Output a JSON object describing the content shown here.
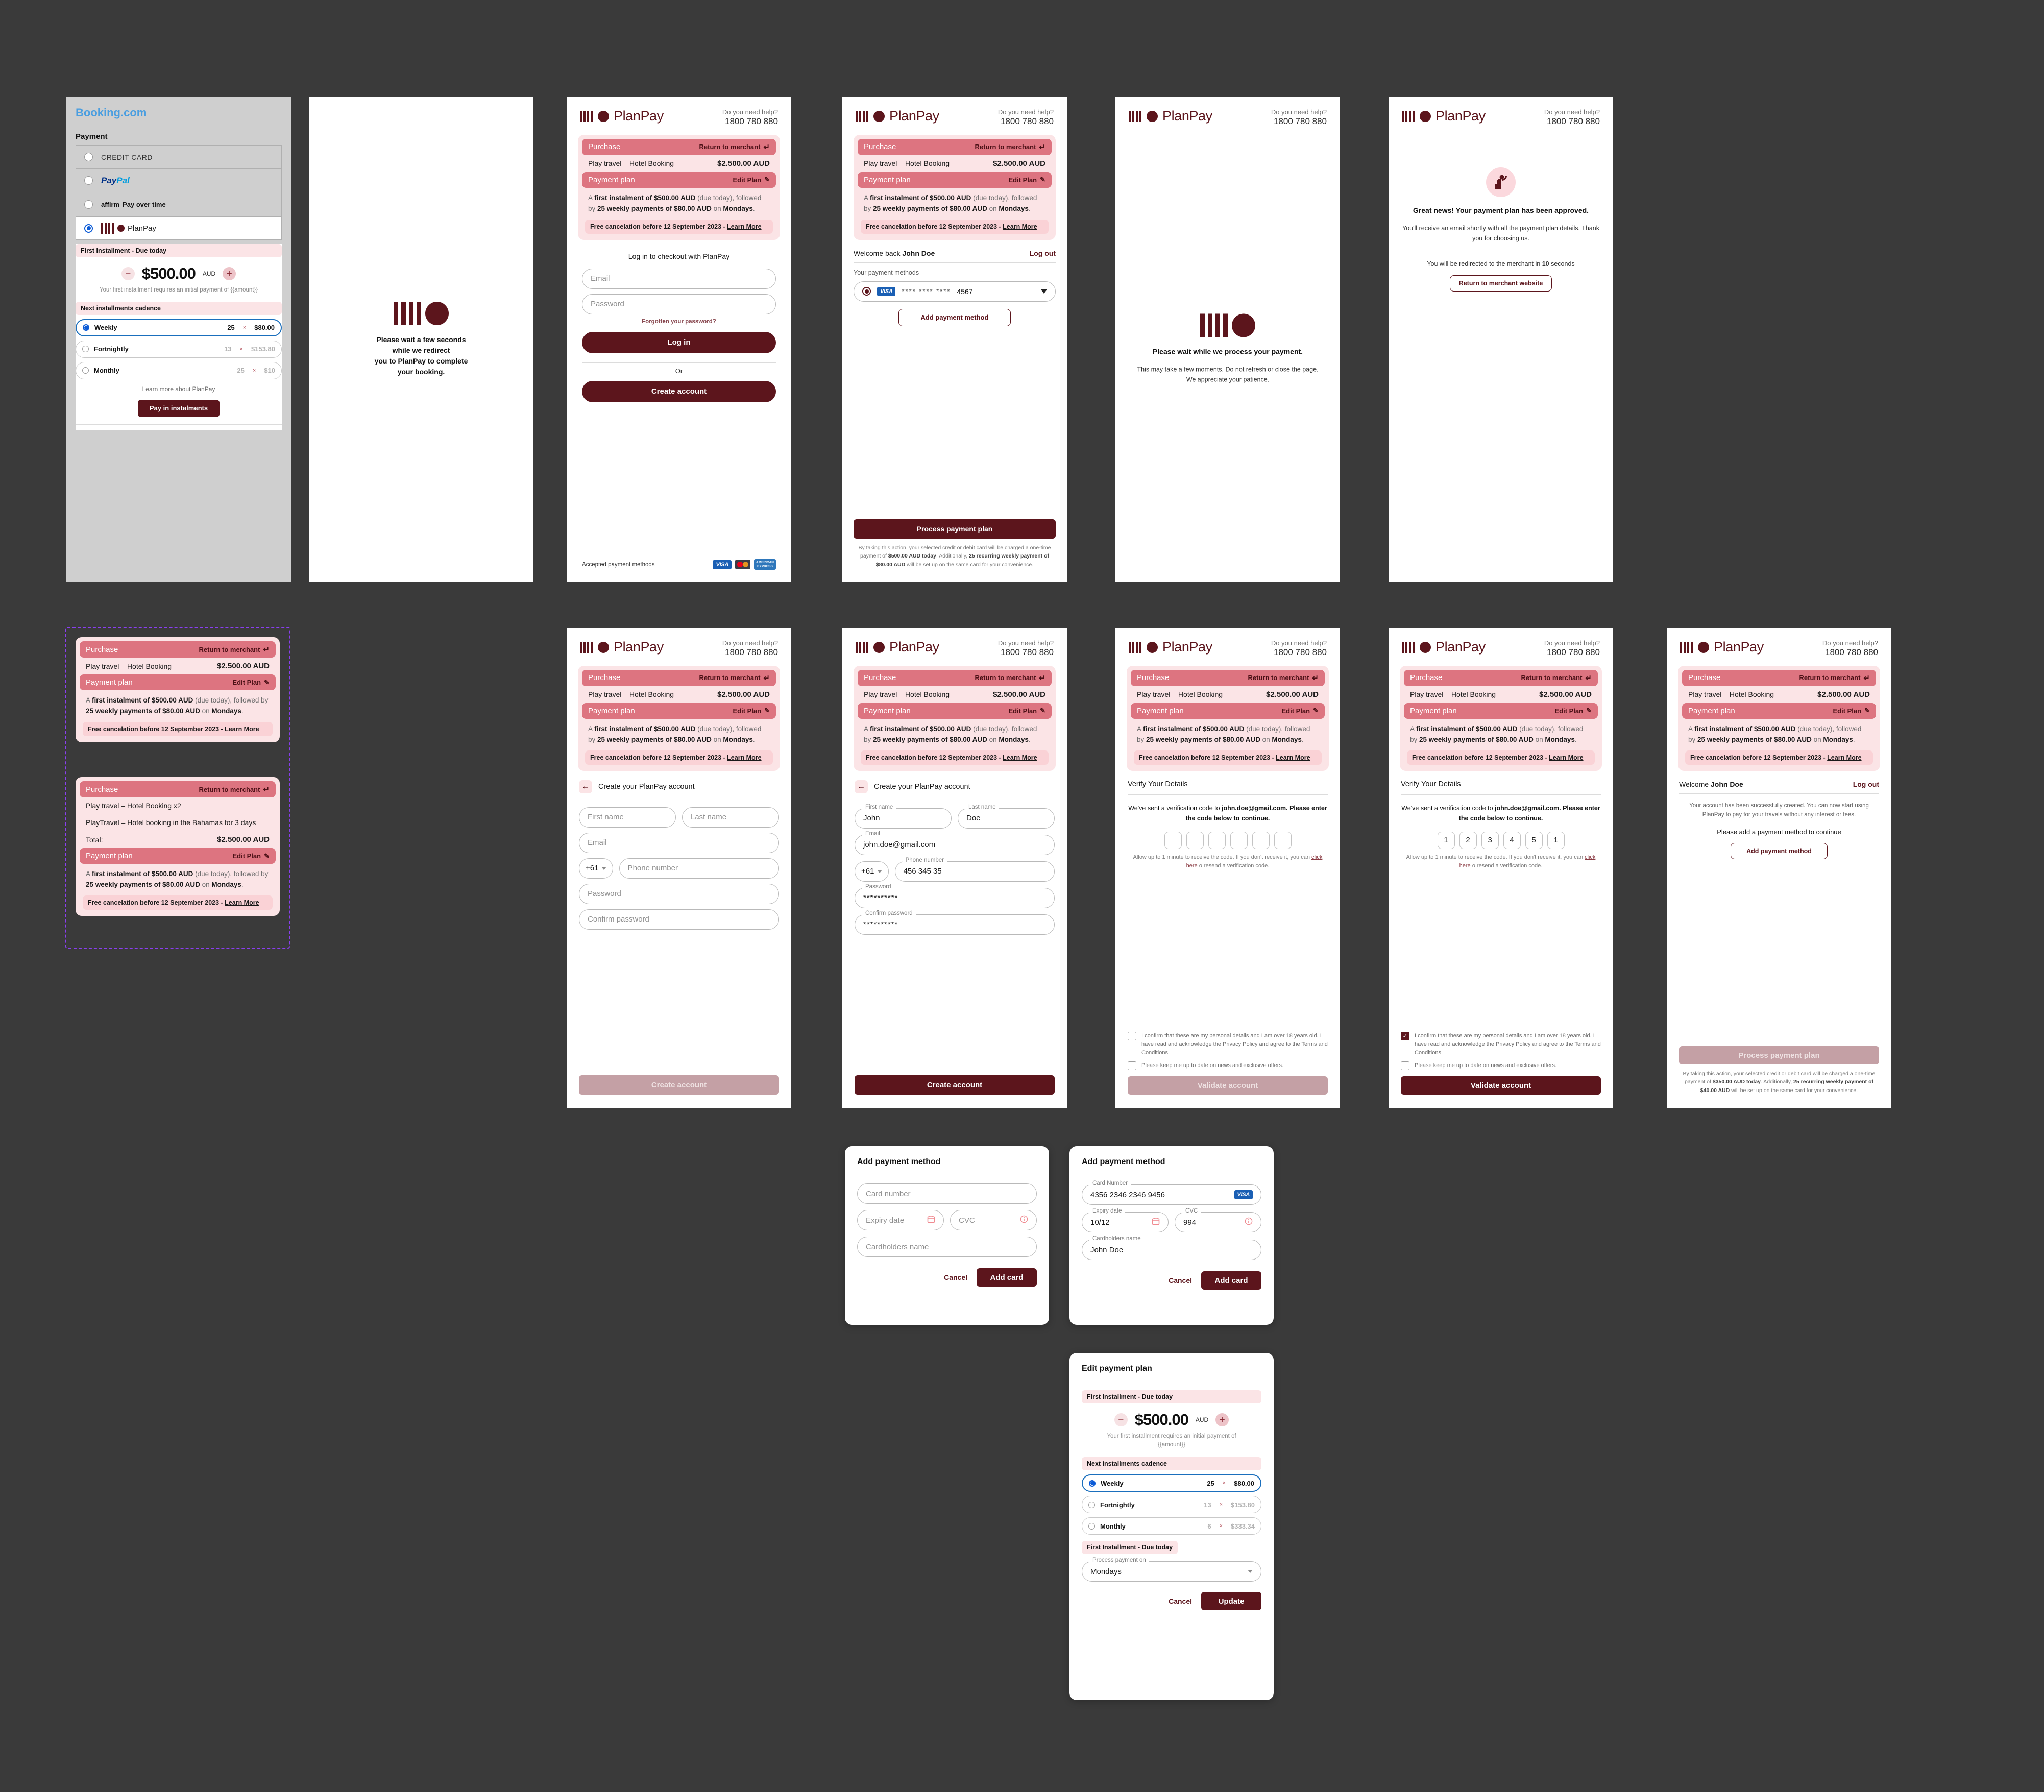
{
  "brand": {
    "name": "PlanPay",
    "accent": "#5c151c",
    "accent_light": "#dd7480",
    "bg_pink": "#fbe4e6",
    "help_question": "Do you need help?",
    "help_phone": "1800 780 880"
  },
  "booking": {
    "logo": "Booking",
    "logo_suffix": ".com",
    "section_title": "Payment",
    "options": [
      {
        "label": "CREDIT CARD",
        "type": "text",
        "selected": false
      },
      {
        "label": "PayPal",
        "type": "paypal",
        "selected": false
      },
      {
        "label": "Pay over time",
        "brand": "affirm",
        "type": "affirm",
        "selected": false
      },
      {
        "label": "PlanPay",
        "type": "planpay",
        "selected": true
      }
    ],
    "first_installment_pill": "First Installment  -  Due today",
    "amount": "$500.00",
    "currency": "AUD",
    "amount_note": "Your first installment requires an initial payment of {{amount}}",
    "cadence_pill": "Next installments cadence",
    "cadence": [
      {
        "label": "Weekly",
        "count": "25",
        "times": "×",
        "amount": "$80.00",
        "selected": true
      },
      {
        "label": "Fortnightly",
        "count": "13",
        "times": "×",
        "amount": "$153.80",
        "selected": false
      },
      {
        "label": "Monthly",
        "count": "25",
        "times": "×",
        "amount": "$10",
        "selected": false
      }
    ],
    "learn_more": "Learn more about PlanPay",
    "pay_button": "Pay in instalments"
  },
  "redirect": {
    "line1": "Please wait a few seconds",
    "line2": "while we redirect",
    "line3": "you to PlanPay to complete",
    "line4": "your booking."
  },
  "processing": {
    "title": "Please wait while we process your payment.",
    "subtitle": "This may take a few moments. Do not refresh or close the page. We appreciate your patience."
  },
  "summary": {
    "purchase_label": "Purchase",
    "return_to_merchant": "Return to merchant",
    "item": "Play travel – Hotel Booking",
    "item_amount": "$2.500.00 AUD",
    "payment_plan_label": "Payment plan",
    "edit_plan": "Edit Plan",
    "plan_text_1": "A ",
    "plan_text_b1": "first instalment of $500.00 AUD",
    "plan_text_2": " (due today), followed by ",
    "plan_text_b2": "25 weekly payments of $80.00 AUD",
    "plan_text_3": " on ",
    "plan_text_b3": "Mondays",
    "plan_text_4": ".",
    "cancellation": "Free cancelation before 12 September 2023 - ",
    "cancellation_link": "Learn More"
  },
  "summary_multi": {
    "item": "Play travel – Hotel Booking x2",
    "item2": "PlayTravel – Hotel booking in the Bahamas for 3 days",
    "total_label": "Total:",
    "total_amount": "$2.500.00 AUD"
  },
  "login": {
    "title": "Log in to checkout with PlanPay",
    "email_placeholder": "Email",
    "password_placeholder": "Password",
    "forgot": "Forgotten your password?",
    "login_button": "Log in",
    "or": "Or",
    "create_button": "Create account",
    "accepted_label": "Accepted payment methods"
  },
  "welcome_back": {
    "greeting_prefix": "Welcome back ",
    "name": "John Doe",
    "logout": "Log out",
    "methods_label": "Your payment methods",
    "card_brand": "VISA",
    "card_mask": "****   ****   ****",
    "card_last4": "4567",
    "add_method": "Add payment method",
    "process_button": "Process payment plan",
    "legal_1": "By taking this action, your selected credit or debit card will be charged a one-time payment of ",
    "legal_b1": "$500.00 AUD today",
    "legal_2": ". Additionally, ",
    "legal_b2": "25 recurring weekly payment of $80.00 AUD",
    "legal_3": " will be set up on the same card for your convenience."
  },
  "approved": {
    "title": "Great news! Your payment plan has been approved.",
    "subtitle": "You'll receive an email shortly with all the payment plan details. Thank you for choosing us.",
    "redirect_prefix": "You will be redirected to the merchant in ",
    "redirect_seconds": "10",
    "redirect_suffix": " seconds",
    "return_button": "Return to merchant website"
  },
  "create_account": {
    "title": "Create your PlanPay account",
    "fields": {
      "first_name": "First name",
      "last_name": "Last name",
      "email": "Email",
      "country_code": "+61",
      "phone": "Phone number",
      "password": "Password",
      "confirm_password": "Confirm password"
    },
    "values": {
      "first_name": "John",
      "last_name": "Doe",
      "email": "john.doe@gmail.com",
      "phone": "456 345 35",
      "password": "**********",
      "confirm_password": "**********"
    },
    "submit": "Create account"
  },
  "verify": {
    "title": "Verify Your Details",
    "msg_1": "We've sent a verification code to ",
    "msg_email": "john.doe@gmail.com",
    "msg_2": ". Please enter the code below to continue.",
    "code_empty": [
      "",
      "",
      "",
      "",
      "",
      ""
    ],
    "code_filled": [
      "1",
      "2",
      "3",
      "4",
      "5",
      "1"
    ],
    "resend_1": "Allow up to 1 minute to receive the code. If you don't receive it, you can ",
    "resend_link": "click here",
    "resend_2": " o resend a verification code.",
    "consent_1": "I confirm that these are my personal details and I am over 18 years old. I have read and acknowledge the Privacy Policy and agree to the Terms and Conditions.",
    "consent_2": "Please keep me up to date on news and exclusive offers.",
    "submit": "Validate account"
  },
  "account_created": {
    "greeting_prefix": "Welcome ",
    "name": "John Doe",
    "logout": "Log out",
    "body": "Your account has been successfully created. You can now start using PlanPay to pay for your travels without any interest or fees.",
    "cta_line": "Please add a payment method to continue",
    "add_method": "Add payment method",
    "process_button": "Process payment plan",
    "legal_1": "By taking this action, your selected credit or debit card will be charged a one-time payment of ",
    "legal_b1": "$350.00 AUD today",
    "legal_2": ". Additionally, ",
    "legal_b2": "25 recurring weekly payment of $40.00 AUD",
    "legal_3": " will be set up on the same card for your convenience."
  },
  "add_payment_modal": {
    "title": "Add payment method",
    "placeholders": {
      "card_number": "Card number",
      "expiry": "Expiry date",
      "cvc": "CVC",
      "name": "Cardholders name"
    },
    "labels": {
      "card_number": "Card Number",
      "expiry": "Expiry date",
      "cvc": "CVC",
      "name": "Cardholders name"
    },
    "values": {
      "card_number": "4356 2346 2346 9456",
      "expiry": "10/12",
      "cvc": "994",
      "name": "John Doe",
      "card_brand": "VISA"
    },
    "cancel": "Cancel",
    "submit": "Add card"
  },
  "edit_plan_modal": {
    "title": "Edit payment plan",
    "first_pill": "First Installment  -  Due today",
    "amount": "$500.00",
    "currency": "AUD",
    "amount_note": "Your first installment requires an initial payment of {{amount}}",
    "cadence_pill": "Next installments cadence",
    "cadence": [
      {
        "label": "Weekly",
        "count": "25",
        "times": "×",
        "amount": "$80.00",
        "selected": true
      },
      {
        "label": "Fortnightly",
        "count": "13",
        "times": "×",
        "amount": "$153.80",
        "selected": false
      },
      {
        "label": "Monthly",
        "count": "6",
        "times": "×",
        "amount": "$333.34",
        "selected": false
      }
    ],
    "second_pill": "First Installment  -  Due today",
    "process_on_label": "Process payment on",
    "process_on_value": "Mondays",
    "cancel": "Cancel",
    "submit": "Update"
  }
}
